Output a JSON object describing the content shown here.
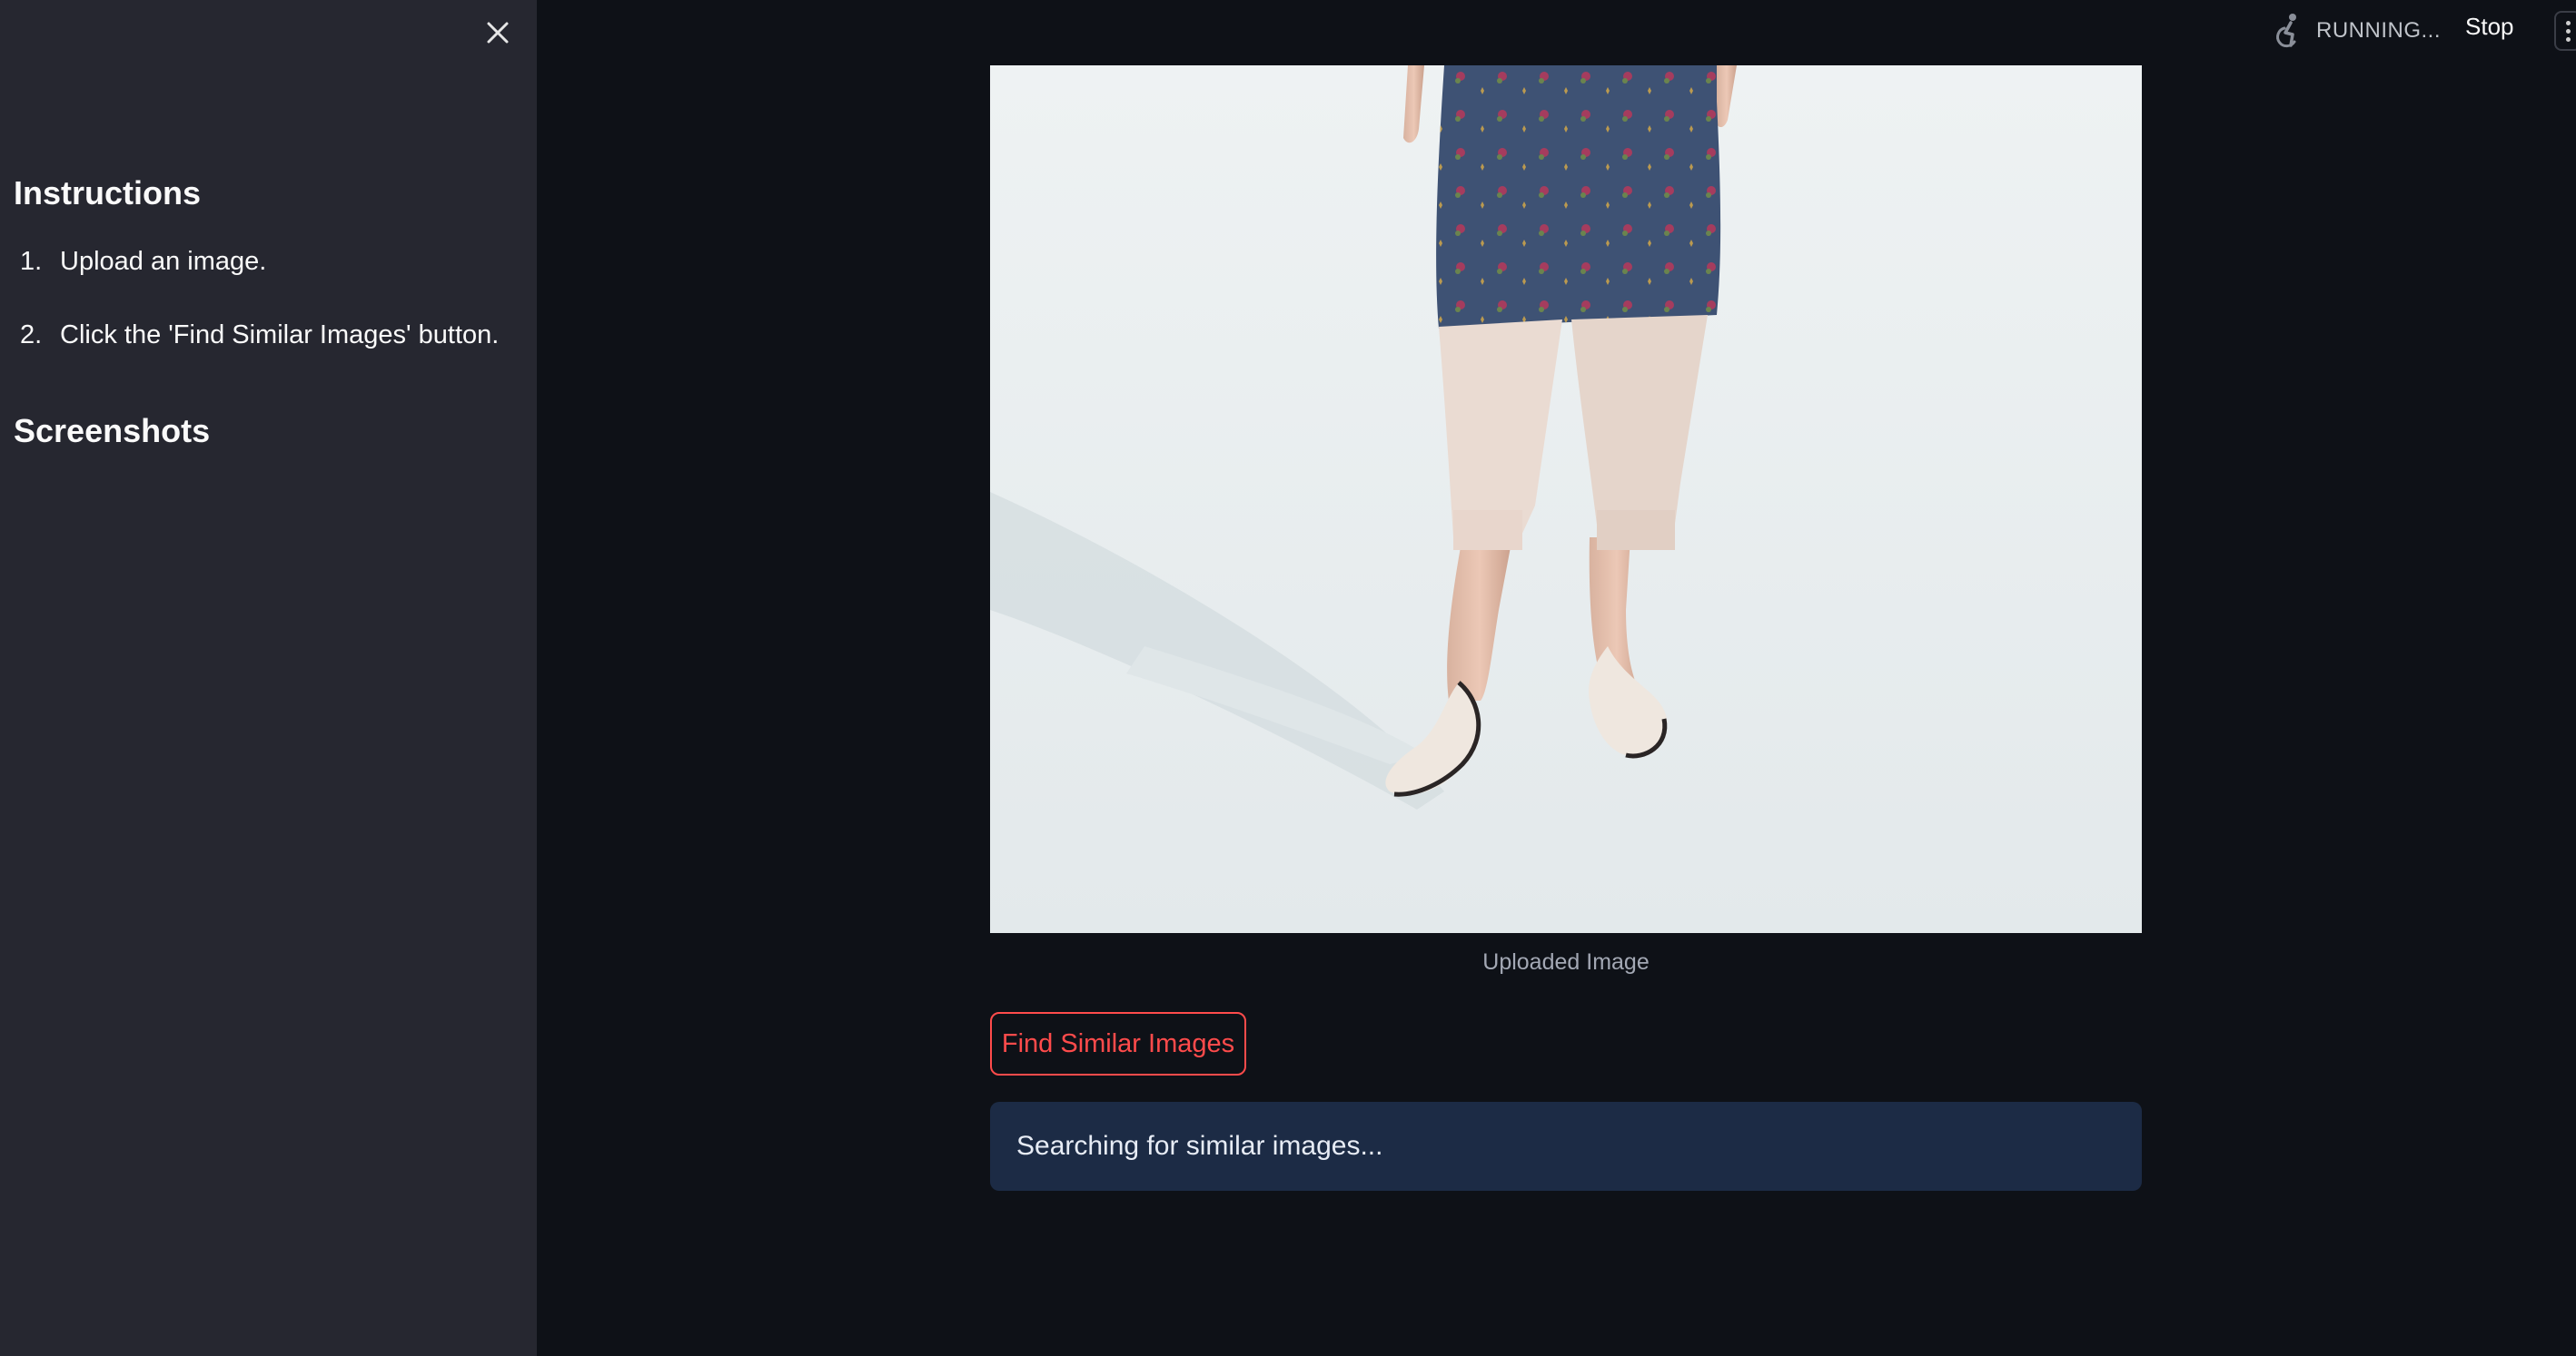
{
  "sidebar": {
    "close_icon": "close-icon",
    "instructions_heading": "Instructions",
    "steps": [
      {
        "num": "1.",
        "text": "Upload an image."
      },
      {
        "num": "2.",
        "text": "Click the 'Find Similar Images' button."
      }
    ],
    "screenshots_heading": "Screenshots"
  },
  "header": {
    "status_icon": "running-person-icon",
    "status_text": "RUNNING...",
    "stop_label": "Stop",
    "menu_icon": "main-menu-icon"
  },
  "main": {
    "image_caption": "Uploaded Image",
    "find_button_label": "Find Similar Images",
    "info_message": "Searching for similar images..."
  },
  "colors": {
    "background": "#0e1117",
    "sidebar": "#262730",
    "accent": "#ff4b4b",
    "info_box": "#1c2b45"
  }
}
